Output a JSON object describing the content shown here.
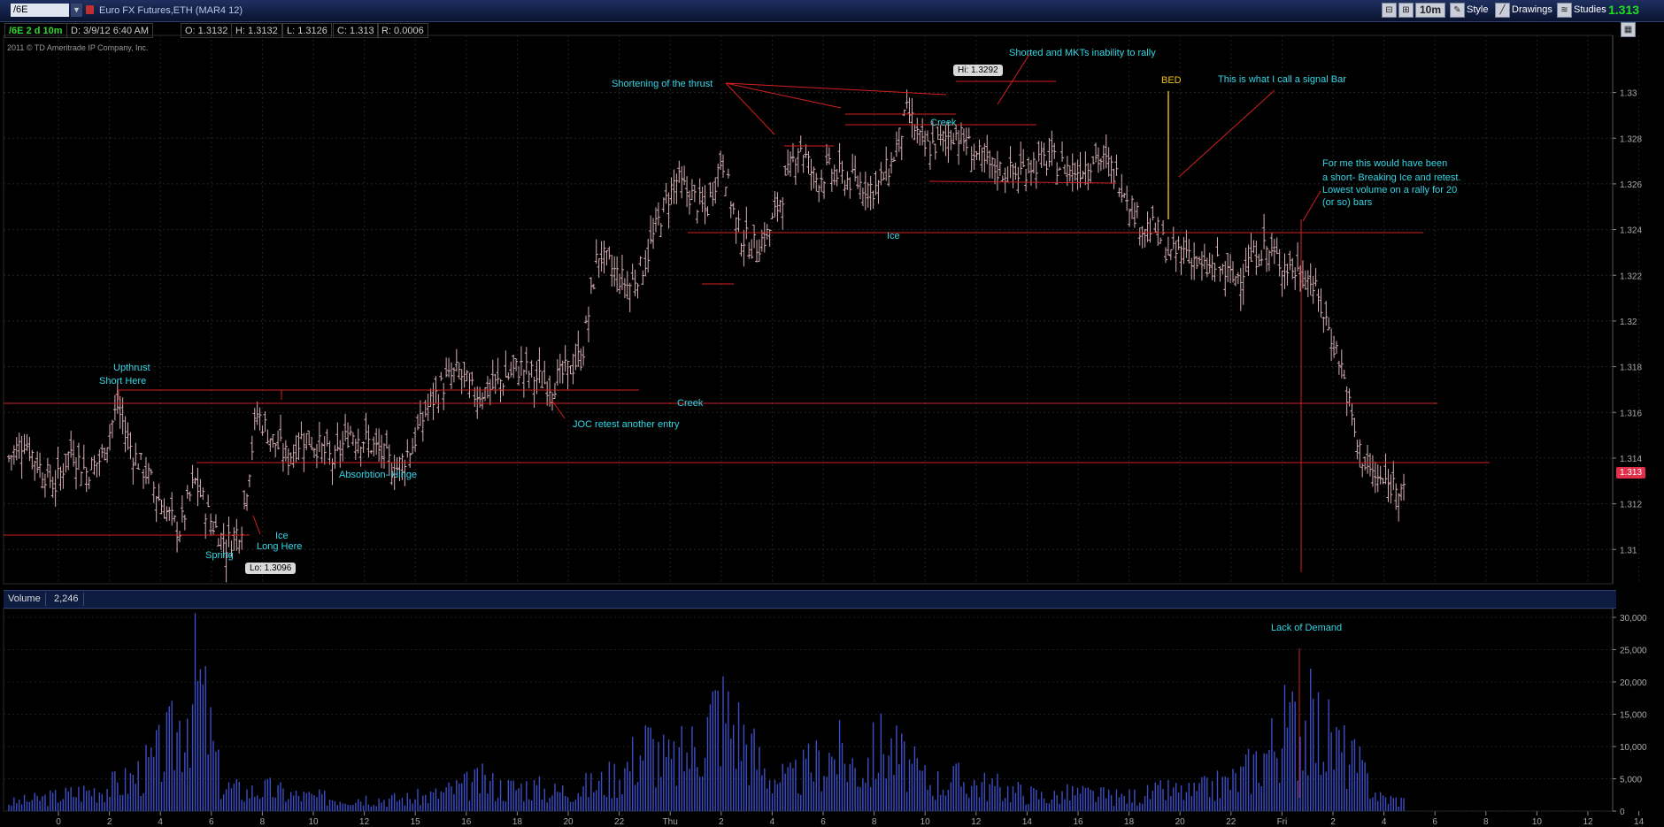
{
  "toolbar": {
    "symbol": "/6E",
    "title": "Euro FX Futures,ETH (MAR4 12)",
    "interval": "10m",
    "style_label": "Style",
    "drawings_label": "Drawings",
    "studies_label": "Studies",
    "last_price": "1.313"
  },
  "info_bar": {
    "symbol_period": "/6E 2 d 10m",
    "date": "D: 3/9/12 6:40 AM",
    "open": "O: 1.3132",
    "high": "H: 1.3132",
    "low": "L: 1.3126",
    "close": "C: 1.313",
    "range": "R: 0.0006"
  },
  "copyright": "2011 © TD Ameritrade IP Company, Inc.",
  "price_tag": "1.313",
  "hi_label": "Hi: 1.3292",
  "lo_label": "Lo: 1.3096",
  "volume_panel": {
    "label": "Volume",
    "value": "2,246"
  },
  "annotations": {
    "upthrust": "Upthrust",
    "short_here": "Short Here",
    "spring": "Spring",
    "ice_left": "Ice",
    "long_here": "Long Here",
    "absorbtion": "Absorbtion- Hinge",
    "joc": "JOC retest another entry",
    "creek_mid": "Creek",
    "shortening": "Shortening of the thrust",
    "creek_top": "Creek",
    "ice_top": "Ice",
    "shorted": "Shorted and MKTs inability to rally",
    "bed": "BED",
    "signal_bar": "This is what I call a signal Bar",
    "for_me_1": "For me this would have been",
    "for_me_2": "a short- Breaking Ice and retest.",
    "for_me_3": "Lowest volume on a rally for 20",
    "for_me_4": "(or so) bars",
    "lack_demand": "Lack of Demand"
  },
  "chart_data": [
    {
      "type": "ohlc",
      "title": "Euro FX Futures,ETH (MAR4 12)",
      "ylim": [
        1.3085,
        1.3325
      ],
      "y_ticks": [
        "1.33",
        "1.328",
        "1.326",
        "1.324",
        "1.322",
        "1.32",
        "1.318",
        "1.316",
        "1.314",
        "1.312",
        "1.31"
      ],
      "x_ticks": [
        "0",
        "2",
        "4",
        "6",
        "8",
        "10",
        "12",
        "15",
        "16",
        "18",
        "20",
        "22",
        "Thu",
        "2",
        "4",
        "6",
        "8",
        "10",
        "12",
        "14",
        "16",
        "18",
        "20",
        "22",
        "Fri",
        "2",
        "4",
        "6",
        "8",
        "10",
        "12",
        "14"
      ],
      "close_path": [
        1.314,
        1.3148,
        1.3136,
        1.3128,
        1.3144,
        1.3134,
        1.314,
        1.3163,
        1.3142,
        1.3132,
        1.3118,
        1.3108,
        1.313,
        1.3113,
        1.3102,
        1.311,
        1.316,
        1.3148,
        1.314,
        1.315,
        1.3145,
        1.3138,
        1.3152,
        1.3148,
        1.3142,
        1.3135,
        1.3145,
        1.3162,
        1.3172,
        1.3178,
        1.3168,
        1.317,
        1.3175,
        1.318,
        1.3175,
        1.3172,
        1.3178,
        1.3185,
        1.323,
        1.3222,
        1.3215,
        1.3225,
        1.3245,
        1.3262,
        1.3255,
        1.3248,
        1.3272,
        1.324,
        1.3232,
        1.3238,
        1.3258,
        1.3278,
        1.3262,
        1.3266,
        1.3262,
        1.326,
        1.3258,
        1.327,
        1.3292,
        1.3275,
        1.3278,
        1.3283,
        1.3276,
        1.3268,
        1.3266,
        1.3264,
        1.3269,
        1.327,
        1.3268,
        1.3266,
        1.3272,
        1.3268,
        1.3258,
        1.3242,
        1.324,
        1.3228,
        1.3232,
        1.3222,
        1.3224,
        1.3218,
        1.3226,
        1.3232,
        1.3226,
        1.3222,
        1.3218,
        1.32,
        1.318,
        1.3145,
        1.3132,
        1.3128,
        1.313
      ],
      "annotations": [
        {
          "text": "Hi: 1.3292"
        },
        {
          "text": "Lo: 1.3096"
        }
      ]
    },
    {
      "type": "bar",
      "title": "Volume",
      "ylim": [
        0,
        30000
      ],
      "y_ticks": [
        "30,000",
        "25,000",
        "20,000",
        "15,000",
        "10,000",
        "5,000",
        "0"
      ],
      "last_value": 2246,
      "volume_profile": [
        1800,
        2500,
        3200,
        4200,
        5000,
        6500,
        10000,
        16000,
        29000,
        5500,
        4200,
        4800,
        3500,
        3000,
        2800,
        3000,
        2600,
        2800,
        3500,
        5000,
        6500,
        5000,
        5500,
        4200,
        5000,
        6000,
        9000,
        15000,
        10000,
        14000,
        23000,
        17000,
        8500,
        6500,
        10000,
        13000,
        9000,
        15000,
        10000,
        6000,
        7000,
        6000,
        5000,
        4000,
        3000,
        4000,
        3500,
        3000,
        3500,
        4500,
        4000,
        5500,
        7000,
        12000,
        18000,
        19500,
        15000,
        10000,
        3000,
        2246
      ]
    }
  ]
}
